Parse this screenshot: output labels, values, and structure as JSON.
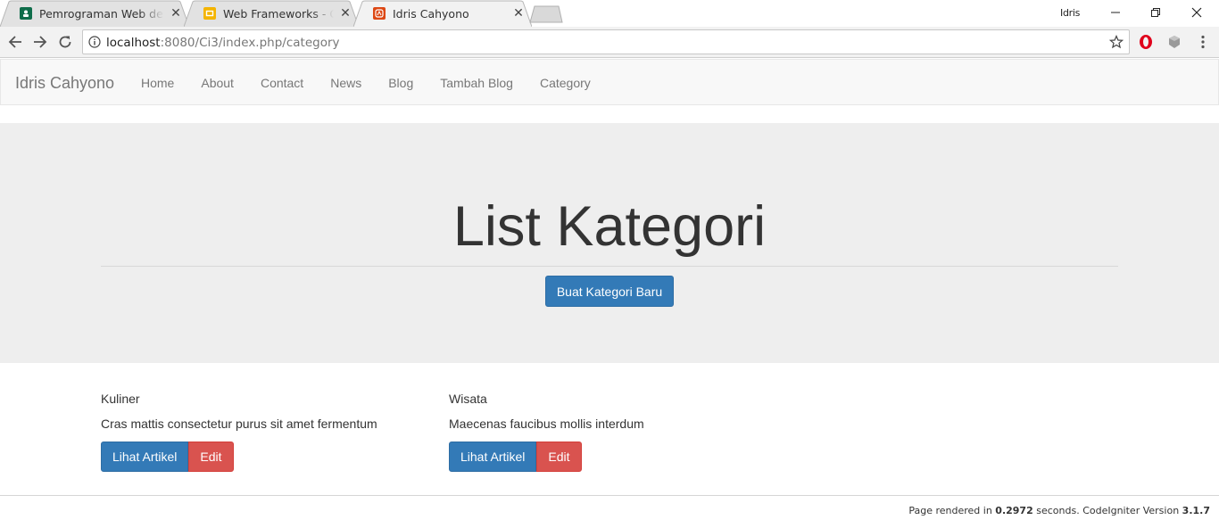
{
  "browser": {
    "tabs": [
      {
        "title": "Pemrograman Web dengan",
        "icon": "classroom-icon",
        "color": "#0f6d4a"
      },
      {
        "title": "Web Frameworks - Google",
        "icon": "slides-icon",
        "color": "#f4b400"
      },
      {
        "title": "Idris Cahyono",
        "icon": "codeigniter-icon",
        "color": "#dd4814"
      }
    ],
    "user": "Idris",
    "url_host": "localhost",
    "url_path": ":8080/Ci3/index.php/category"
  },
  "navbar": {
    "brand": "Idris Cahyono",
    "links": [
      "Home",
      "About",
      "Contact",
      "News",
      "Blog",
      "Tambah Blog",
      "Category"
    ]
  },
  "jumbotron": {
    "title": "List Kategori",
    "button": "Buat Kategori Baru"
  },
  "categories": [
    {
      "name": "Kuliner",
      "description": "Cras mattis consectetur purus sit amet fermentum",
      "view_label": "Lihat Artikel",
      "edit_label": "Edit"
    },
    {
      "name": "Wisata",
      "description": "Maecenas faucibus mollis interdum",
      "view_label": "Lihat Artikel",
      "edit_label": "Edit"
    }
  ],
  "footer": {
    "prefix": "Page rendered in ",
    "time": "0.2972",
    "middle": " seconds. CodeIgniter Version ",
    "version": "3.1.7"
  },
  "colors": {
    "primary": "#337ab7",
    "danger": "#d9534f",
    "jumbotron": "#eeeeee"
  }
}
